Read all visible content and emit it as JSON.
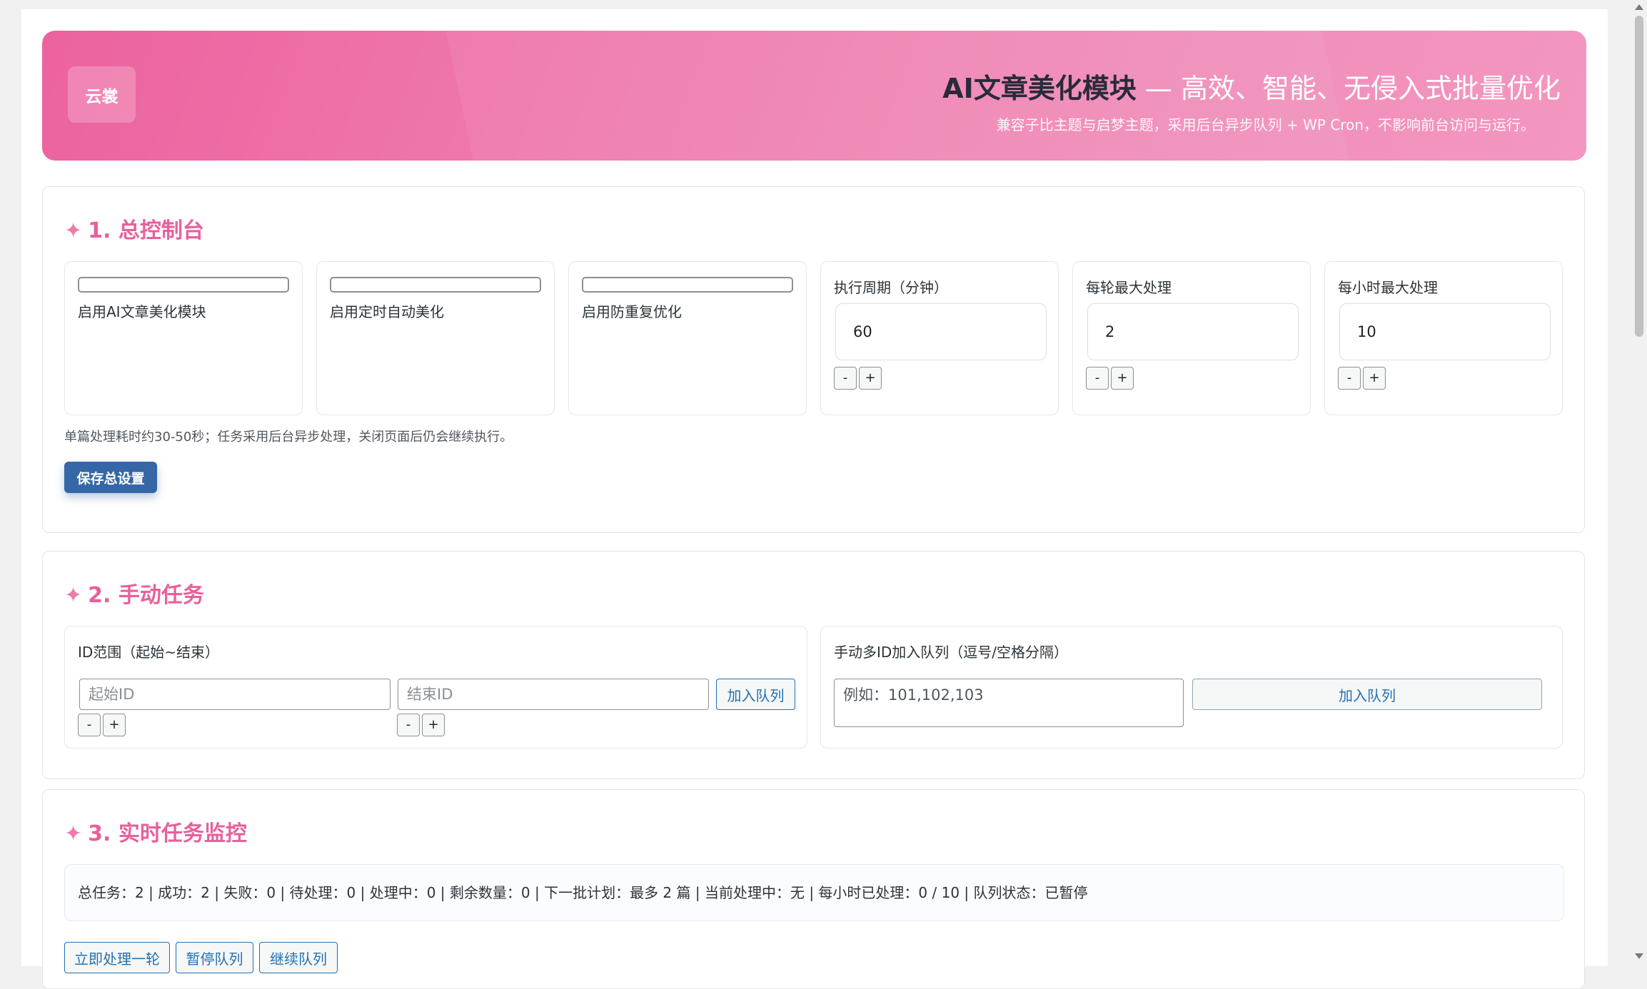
{
  "header": {
    "logo": "云裳",
    "title_strong": "AI文章美化模块",
    "title_rest": " — 高效、智能、无侵入式批量优化",
    "subtitle": "兼容子比主题与启梦主题，采用后台异步队列 + WP Cron，不影响前台访问与运行。"
  },
  "section1": {
    "star": "✦",
    "title": "1. 总控制台",
    "toggles": [
      {
        "label": "启用AI文章美化模块"
      },
      {
        "label": "启用定时自动美化"
      },
      {
        "label": "启用防重复优化"
      }
    ],
    "numbers": [
      {
        "label": "执行周期（分钟）",
        "value": "60"
      },
      {
        "label": "每轮最大处理",
        "value": "2"
      },
      {
        "label": "每小时最大处理",
        "value": "10"
      }
    ],
    "minus": "-",
    "plus": "+",
    "hint": "单篇处理耗时约30-50秒；任务采用后台异步处理，关闭页面后仍会继续执行。",
    "save_label": "保存总设置"
  },
  "section2": {
    "star": "✦",
    "title": "2. 手动任务",
    "range": {
      "label": "ID范围（起始~结束）",
      "start_placeholder": "起始ID",
      "end_placeholder": "结束ID",
      "add_label": "加入队列"
    },
    "multi": {
      "label": "手动多ID加入队列（逗号/空格分隔）",
      "placeholder": "例如：101,102,103",
      "add_label": "加入队列"
    },
    "minus": "-",
    "plus": "+"
  },
  "section3": {
    "star": "✦",
    "title": "3. 实时任务监控",
    "status": "总任务：2 | 成功：2 | 失败：0 | 待处理：0 | 处理中：0 | 剩余数量：0 | 下一批计划：最多 2 篇 | 当前处理中：无 | 每小时已处理：0 / 10 | 队列状态：已暂停",
    "buttons": [
      "立即处理一轮",
      "暂停队列",
      "继续队列"
    ]
  }
}
